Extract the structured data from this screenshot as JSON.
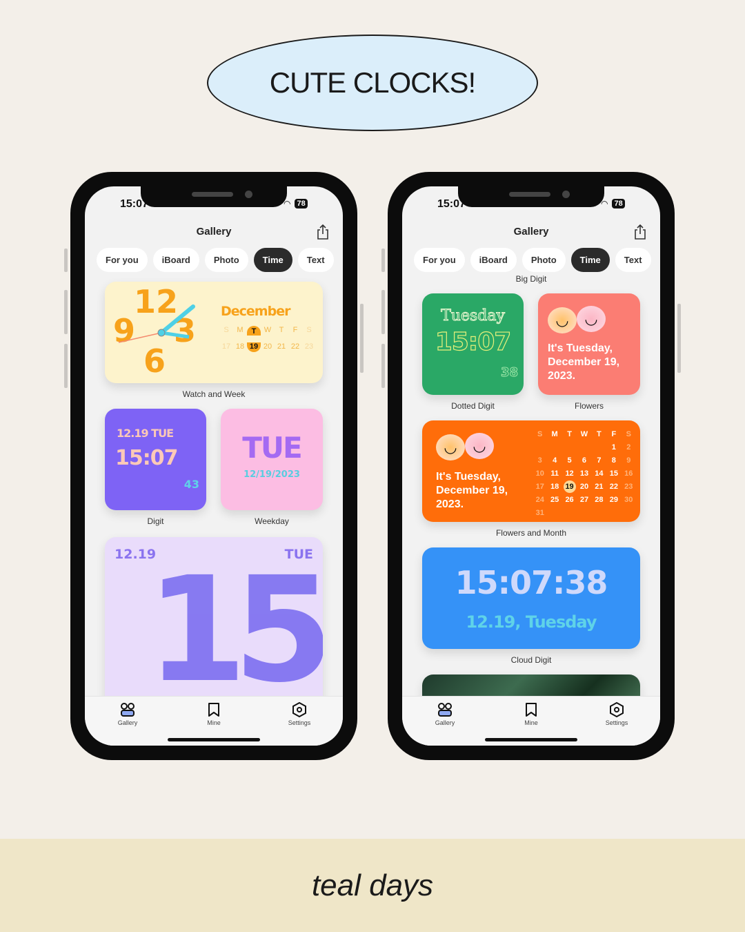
{
  "banner": {
    "title": "CUTE CLOCKS!"
  },
  "footer": {
    "text": "teal days"
  },
  "status": {
    "time": "15:07",
    "battery": "78"
  },
  "header": {
    "title": "Gallery",
    "share_icon": "share-icon"
  },
  "tabs": [
    {
      "label": "For you"
    },
    {
      "label": "iBoard"
    },
    {
      "label": "Photo"
    },
    {
      "label": "Time",
      "active": true
    },
    {
      "label": "Text"
    }
  ],
  "tabbar": [
    {
      "label": "Gallery",
      "icon": "gallery-icon"
    },
    {
      "label": "Mine",
      "icon": "bookmark-icon"
    },
    {
      "label": "Settings",
      "icon": "settings-icon"
    }
  ],
  "left": {
    "watch": {
      "name": "Watch and Week",
      "month": "December",
      "days": [
        "S",
        "M",
        "T",
        "W",
        "T",
        "F",
        "S"
      ],
      "dates": [
        "17",
        "18",
        "19",
        "20",
        "21",
        "22",
        "23"
      ],
      "n12": "12",
      "n9": "9",
      "n3": "3",
      "n6": "6"
    },
    "digit": {
      "name": "Digit",
      "date": "12.19 TUE",
      "time": "15:07",
      "sec": "43"
    },
    "weekday": {
      "name": "Weekday",
      "day": "TUE",
      "date": "12/19/2023"
    },
    "big": {
      "date": "12.19",
      "day": "TUE",
      "hour": "15"
    }
  },
  "right": {
    "section": "Big Digit",
    "dotted": {
      "name": "Dotted Digit",
      "day": "Tuesday",
      "time": "15:07",
      "sec": "38"
    },
    "flowers": {
      "name": "Flowers",
      "text": "It's Tuesday, December 19, 2023."
    },
    "month": {
      "name": "Flowers and Month",
      "text": "It's Tuesday, December 19, 2023.",
      "days": [
        "S",
        "M",
        "T",
        "W",
        "T",
        "F",
        "S"
      ],
      "weeks": [
        [
          "",
          "",
          "",
          "",
          "",
          "1",
          "2"
        ],
        [
          "3",
          "4",
          "5",
          "6",
          "7",
          "8",
          "9"
        ],
        [
          "10",
          "11",
          "12",
          "13",
          "14",
          "15",
          "16"
        ],
        [
          "17",
          "18",
          "19",
          "20",
          "21",
          "22",
          "23"
        ],
        [
          "24",
          "25",
          "26",
          "27",
          "28",
          "29",
          "30"
        ],
        [
          "31",
          "",
          "",
          "",
          "",
          "",
          ""
        ]
      ]
    },
    "cloud": {
      "name": "Cloud Digit",
      "time": "15:07:38",
      "date": "12.19, Tuesday"
    }
  },
  "colors": {
    "watch_bg": "#fdf3cc",
    "orange": "#f7a21b",
    "digit_bg": "#7e63f5",
    "weekday_bg": "#fcbde3",
    "big_bg": "#e9dcfb",
    "green": "#2aa866",
    "coral": "#fb7d73",
    "month_bg": "#ff6d0a",
    "cloud_bg": "#3592f7"
  }
}
